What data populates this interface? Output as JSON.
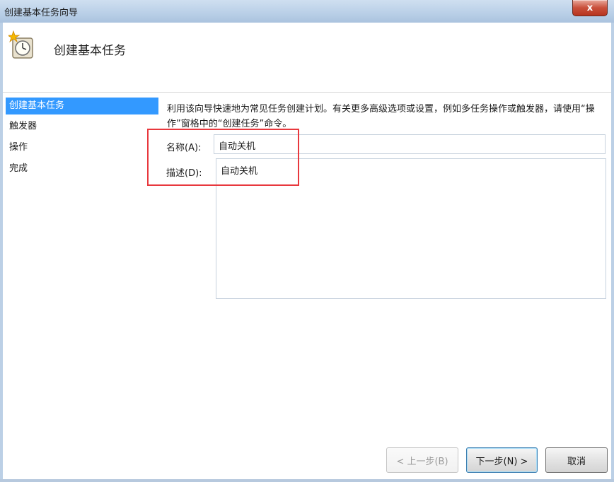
{
  "window": {
    "title": "创建基本任务向导",
    "close_label": "x"
  },
  "header": {
    "title": "创建基本任务",
    "icon": "clock-icon"
  },
  "sidebar": {
    "items": [
      {
        "label": "创建基本任务",
        "active": true
      },
      {
        "label": "触发器",
        "active": false
      },
      {
        "label": "操作",
        "active": false
      },
      {
        "label": "完成",
        "active": false
      }
    ]
  },
  "main": {
    "description": "利用该向导快速地为常见任务创建计划。有关更多高级选项或设置，例如多任务操作或触发器，请使用“操作”窗格中的“创建任务”命令。",
    "name_label": "名称(A):",
    "name_value": "自动关机",
    "desc_label": "描述(D):",
    "desc_value": "自动关机"
  },
  "buttons": {
    "back": "< 上一步(B)",
    "next": "下一步(N) >",
    "cancel": "取消"
  },
  "colors": {
    "active_step": "#3399ff",
    "highlight": "#e8383d"
  }
}
